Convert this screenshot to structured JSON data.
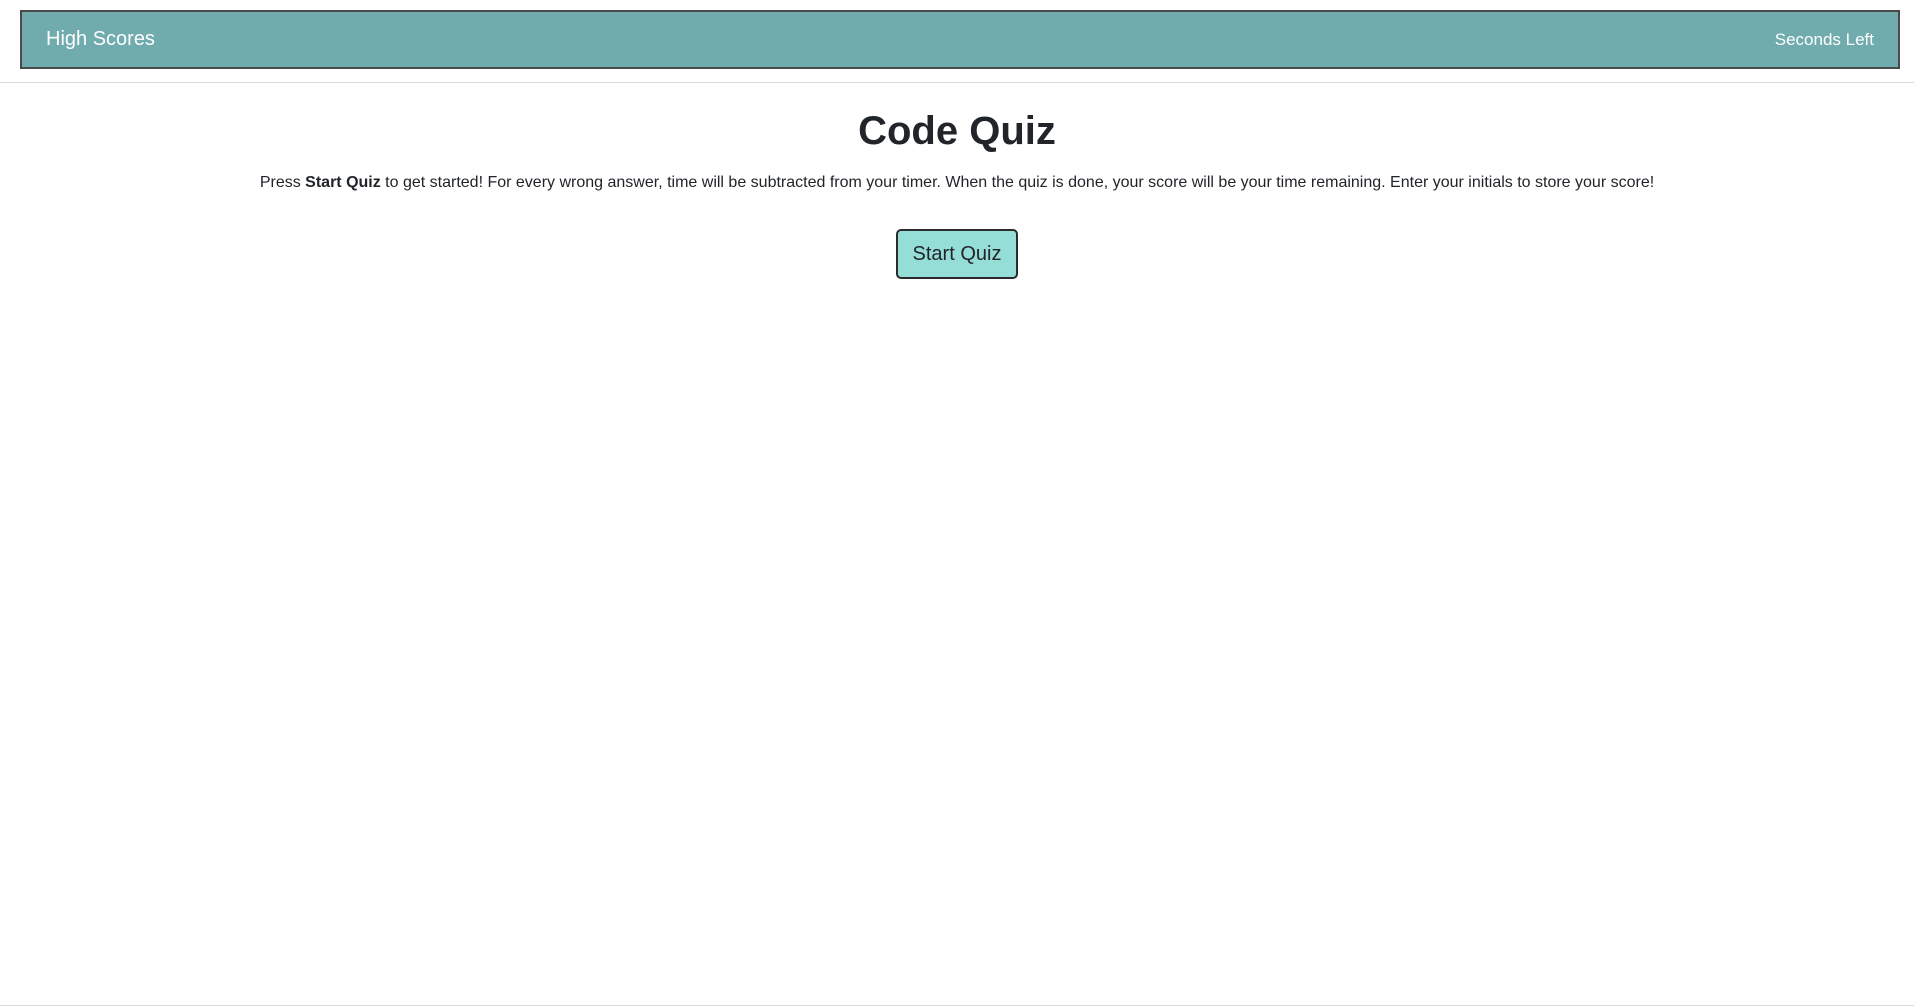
{
  "header": {
    "high_scores_label": "High Scores",
    "timer_label": "Seconds Left"
  },
  "main": {
    "title": "Code Quiz",
    "instructions_prefix": "Press ",
    "instructions_bold": "Start Quiz",
    "instructions_suffix": " to get started! For every wrong answer, time will be subtracted from your timer. When the quiz is done, your score will be your time remaining. Enter your initials to store your score!",
    "start_button_label": "Start Quiz"
  },
  "colors": {
    "navbar_bg": "#70abae",
    "button_bg": "#95ddd7",
    "text": "#212529"
  }
}
